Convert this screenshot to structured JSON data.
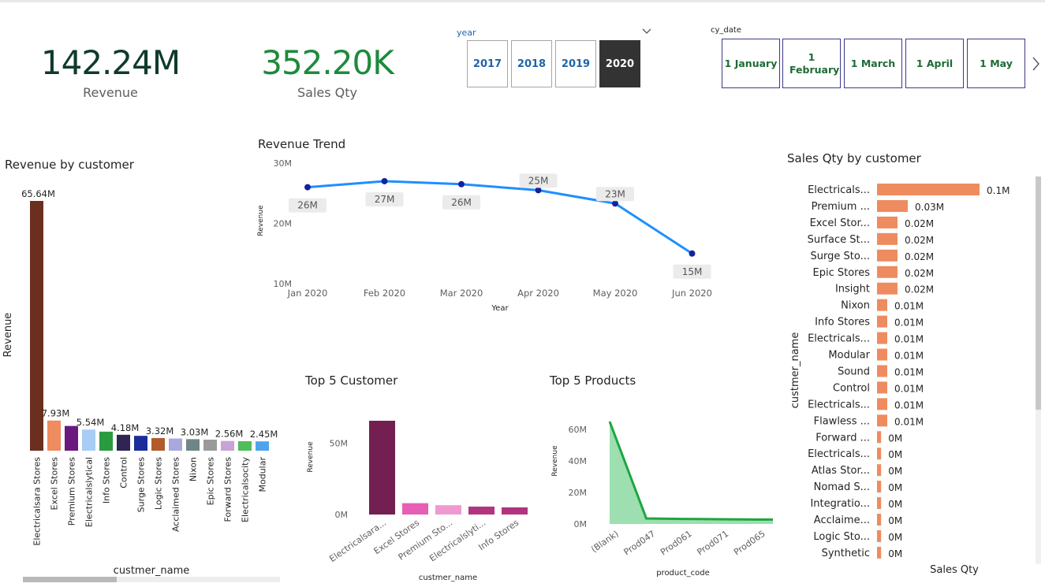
{
  "kpis": {
    "revenue": {
      "value": "142.24M",
      "label": "Revenue",
      "color": "#0f3a2e"
    },
    "sales_qty": {
      "value": "352.20K",
      "label": "Sales Qty",
      "color": "#1d8a3b"
    }
  },
  "year_slicer": {
    "title": "year",
    "options": [
      "2017",
      "2018",
      "2019",
      "2020"
    ],
    "selected": "2020",
    "dropdown_icon": "chevron-down-icon"
  },
  "date_slicer": {
    "title": "cy_date",
    "options": [
      "1 January",
      "1 February",
      "1 March",
      "1 April",
      "1 May"
    ],
    "next_icon": "chevron-right-icon"
  },
  "revenue_by_customer": {
    "title": "Revenue by customer",
    "xlabel": "custmer_name",
    "ylabel": "Revenue",
    "chart_data": {
      "type": "bar",
      "categories": [
        "Electricalsara Stores",
        "Excel Stores",
        "Premium Stores",
        "Electricalslytical",
        "Info Stores",
        "Control",
        "Surge Stores",
        "Logic Stores",
        "Acclaimed Stores",
        "Nixon",
        "Epic Stores",
        "Forward Stores",
        "Electricalsocity",
        "Modular"
      ],
      "values": [
        65.64,
        7.93,
        6.5,
        5.54,
        5.0,
        4.18,
        3.9,
        3.32,
        3.2,
        3.03,
        2.9,
        2.56,
        2.5,
        2.45
      ],
      "data_labels": [
        "65.64M",
        "7.93M",
        "",
        "5.54M",
        "",
        "4.18M",
        "",
        "3.32M",
        "",
        "3.03M",
        "",
        "2.56M",
        "",
        "2.45M"
      ],
      "colors": [
        "#6b2f1e",
        "#ee8c5f",
        "#6a1a7e",
        "#a7cdf5",
        "#2a9c3f",
        "#2f2454",
        "#1b2d9a",
        "#b25a2c",
        "#a8a8dd",
        "#6e8686",
        "#9a9a9a",
        "#c9a3d6",
        "#4fbd5a",
        "#4da3ef"
      ],
      "ylim": [
        0,
        70
      ]
    }
  },
  "revenue_trend": {
    "title": "Revenue Trend",
    "xlabel": "Year",
    "ylabel": "Revenue",
    "chart_data": {
      "type": "line",
      "categories": [
        "Jan 2020",
        "Feb 2020",
        "Mar 2020",
        "Apr 2020",
        "May 2020",
        "Jun 2020"
      ],
      "values": [
        26,
        27,
        26.5,
        25.5,
        23.3,
        15
      ],
      "data_labels": [
        "26M",
        "27M",
        "26M",
        "25M",
        "23M",
        "15M"
      ],
      "yticks": [
        "10M",
        "20M",
        "30M"
      ],
      "ylim": [
        10,
        30
      ],
      "color": "#1e8fff"
    }
  },
  "top5_customer": {
    "title": "Top 5 Customer",
    "xlabel": "custmer_name",
    "ylabel": "Revenue",
    "chart_data": {
      "type": "bar",
      "categories": [
        "Electricalsara...",
        "Excel Stores",
        "Premium Sto...",
        "Electricalslyti...",
        "Info Stores"
      ],
      "values": [
        65.64,
        7.93,
        6.5,
        5.54,
        5.0
      ],
      "colors": [
        "#731f52",
        "#e65fb4",
        "#ee99d0",
        "#b0357e",
        "#b0357e"
      ],
      "yticks": [
        "0M",
        "50M"
      ],
      "ylim": [
        0,
        70
      ]
    }
  },
  "top5_products": {
    "title": "Top 5 Products",
    "xlabel": "product_code",
    "ylabel": "Revenue",
    "chart_data": {
      "type": "area",
      "categories": [
        "(Blank)",
        "Prod047",
        "Prod061",
        "Prod071",
        "Prod065"
      ],
      "values": [
        65,
        3.5,
        3.2,
        3.0,
        2.8
      ],
      "yticks": [
        "0M",
        "20M",
        "40M",
        "60M"
      ],
      "ylim": [
        0,
        70
      ],
      "line_color": "#1ea542",
      "fill_color": "#9ddfb0"
    }
  },
  "sales_qty_by_customer": {
    "title": "Sales Qty by customer",
    "xlabel": "Sales Qty",
    "ylabel": "custmer_name",
    "chart_data": {
      "type": "bar",
      "orientation": "horizontal",
      "categories": [
        "Electricals...",
        "Premium ...",
        "Excel Stor...",
        "Surface St...",
        "Surge Sto...",
        "Epic Stores",
        "Insight",
        "Nixon",
        "Info Stores",
        "Electricals...",
        "Modular",
        "Sound",
        "Control",
        "Electricals...",
        "Flawless ...",
        "Forward ...",
        "Electricals...",
        "Atlas Stor...",
        "Nomad S...",
        "Integratio...",
        "Acclaime...",
        "Logic Sto...",
        "Synthetic"
      ],
      "values": [
        0.1,
        0.03,
        0.02,
        0.02,
        0.02,
        0.02,
        0.02,
        0.01,
        0.01,
        0.01,
        0.01,
        0.01,
        0.01,
        0.01,
        0.01,
        0.004,
        0.004,
        0.004,
        0.004,
        0.004,
        0.004,
        0.004,
        0.004
      ],
      "data_labels": [
        "0.1M",
        "0.03M",
        "0.02M",
        "0.02M",
        "0.02M",
        "0.02M",
        "0.02M",
        "0.01M",
        "0.01M",
        "0.01M",
        "0.01M",
        "0.01M",
        "0.01M",
        "0.01M",
        "0.01M",
        "0M",
        "0M",
        "0M",
        "0M",
        "0M",
        "0M",
        "0M",
        "0M"
      ],
      "color": "#ee8c5f"
    }
  }
}
